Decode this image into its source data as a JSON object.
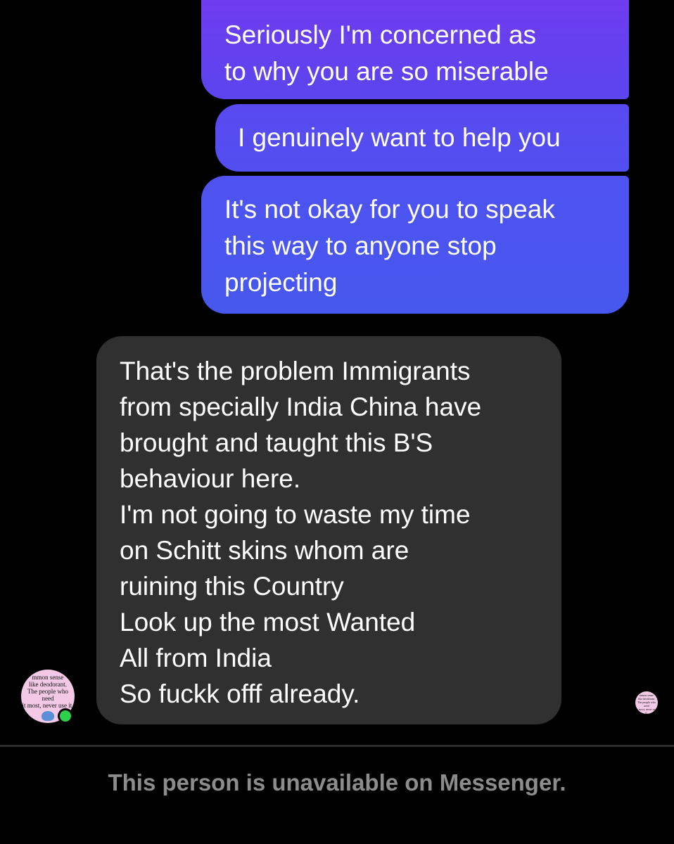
{
  "conversation": {
    "outgoing": [
      "Seriously I'm concerned as\nto why you are so miserable",
      "I genuinely want to help you",
      "It's not okay for you to speak\nthis way to anyone stop\nprojecting"
    ],
    "incoming": [
      "That's the problem Immigrants\nfrom specially India China have\nbrought and taught this B'S\nbehaviour here.\nI'm not going to waste my time\non Schitt skins whom are\nruining this Country\nLook up the most Wanted\nAll from India\nSo fuckk offf already."
    ]
  },
  "contact": {
    "avatar_text": "mmon sense\nlike deodorant.\nThe people who need\nit most, never use it.",
    "online": true,
    "online_color": "#2bd24a",
    "avatar_bg": "#f3c9e6"
  },
  "colors": {
    "outgoing_gradient_top": "#6f3cf0",
    "outgoing_gradient_bottom": "#4658ee",
    "incoming_bubble": "#303030",
    "background": "#000000"
  },
  "footer": {
    "status_text": "This person is unavailable on Messenger."
  }
}
